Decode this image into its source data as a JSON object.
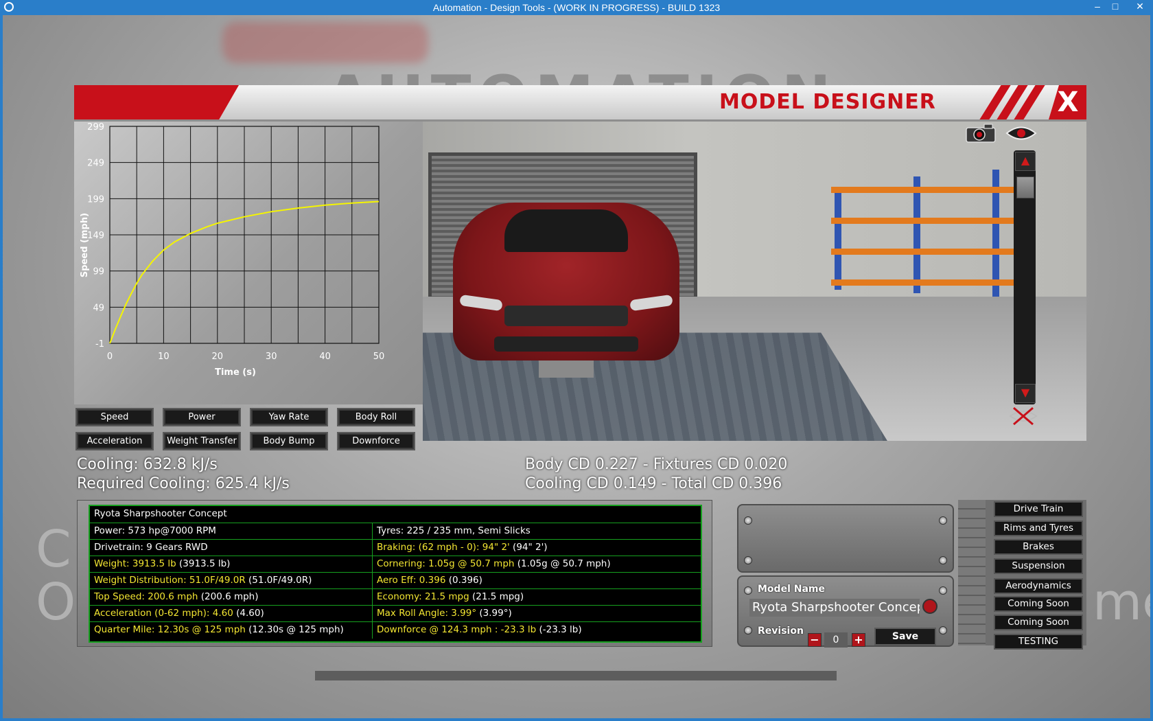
{
  "window": {
    "title": "Automation - Design Tools - (WORK IN PROGRESS) - BUILD 1323",
    "minimize": "–",
    "maximize": "□",
    "close": "✕"
  },
  "background": {
    "logo_text": "AUTOMATION",
    "left_text_1": "C",
    "left_text_2": "O",
    "right_text": "me"
  },
  "header": {
    "title": "MODEL DESIGNER",
    "close_label": "X"
  },
  "chart_data": {
    "type": "line",
    "xlabel": "Time (s)",
    "ylabel": "Speed (mph)",
    "xlim": [
      0,
      50
    ],
    "ylim": [
      -1,
      299
    ],
    "x_ticks": [
      "0",
      "10",
      "20",
      "30",
      "40",
      "50"
    ],
    "y_ticks": [
      "299",
      "249",
      "199",
      "149",
      "99",
      "49",
      "-1"
    ],
    "grid": true,
    "series": [
      {
        "color": "#f5f500",
        "x": [
          0,
          1,
          2,
          3,
          4,
          5,
          6,
          8,
          10,
          12,
          15,
          18,
          20,
          25,
          30,
          35,
          40,
          45,
          50
        ],
        "y": [
          -1,
          18,
          36,
          53,
          68,
          82,
          94,
          113,
          128,
          139,
          151,
          160,
          165,
          174,
          181,
          186,
          190,
          193,
          195
        ]
      }
    ]
  },
  "chart_buttons": {
    "speed": "Speed",
    "power": "Power",
    "yaw_rate": "Yaw Rate",
    "body_roll": "Body Roll",
    "acceleration": "Acceleration",
    "weight_transfer": "Weight Transfer",
    "body_bump": "Body Bump",
    "downforce": "Downforce"
  },
  "summary": {
    "cooling": "Cooling: 632.8 kJ/s",
    "required_cooling": "Required Cooling: 625.4 kJ/s",
    "body_cd": "Body CD 0.227 - Fixtures CD 0.020",
    "cooling_cd": "Cooling CD 0.149 - Total CD 0.396"
  },
  "stats": {
    "car_name": "Ryota Sharpshooter Concept",
    "rows": [
      {
        "left": "Power: 573 hp@7000 RPM",
        "left_color": "#ffffff",
        "right": "Tyres: 225 / 235 mm, Semi Slicks",
        "right_extra": "",
        "right_color": "#ffffff",
        "left_extra": ""
      },
      {
        "left": "Drivetrain: 9 Gears RWD",
        "left_color": "#ffffff",
        "left_extra": "",
        "right": "Braking: (62 mph - 0): 94\" 2'",
        "right_extra": " (94\" 2')",
        "right_color": "#f3e632"
      },
      {
        "left": "Weight: 3913.5 lb",
        "left_extra": " (3913.5 lb)",
        "left_color": "#f3e632",
        "right": "Cornering: 1.05g @ 50.7 mph",
        "right_extra": " (1.05g @ 50.7 mph)",
        "right_color": "#f3e632"
      },
      {
        "left": "Weight Distribution: 51.0F/49.0R",
        "left_extra": " (51.0F/49.0R)",
        "left_color": "#f3e632",
        "right": "Aero Eff: 0.396",
        "right_extra": " (0.396)",
        "right_color": "#f3e632"
      },
      {
        "left": "Top Speed: 200.6 mph",
        "left_extra": " (200.6 mph)",
        "left_color": "#f3e632",
        "right": "Economy: 21.5 mpg",
        "right_extra": " (21.5 mpg)",
        "right_color": "#f3e632"
      },
      {
        "left": "Acceleration (0-62 mph): 4.60",
        "left_extra": " (4.60)",
        "left_color": "#f3e632",
        "right": "Max Roll Angle: 3.99°",
        "right_extra": " (3.99°)",
        "right_color": "#f3e632"
      },
      {
        "left": "Quarter Mile: 12.30s @ 125 mph",
        "left_extra": " (12.30s @ 125 mph)",
        "left_color": "#f3e632",
        "right": "Downforce @ 124.3 mph : -23.3 lb",
        "right_extra": " (-23.3 lb)",
        "right_color": "#f3e632"
      }
    ]
  },
  "model": {
    "name_label": "Model Name",
    "name_value": "Ryota Sharpshooter Concept",
    "revision_label": "Revision",
    "revision_value": "0",
    "minus": "−",
    "plus": "+",
    "save": "Save"
  },
  "side_menu": [
    "Drive Train",
    "Rims and Tyres",
    "Brakes",
    "Suspension",
    "Aerodynamics",
    "Coming Soon",
    "Coming Soon",
    "TESTING"
  ]
}
